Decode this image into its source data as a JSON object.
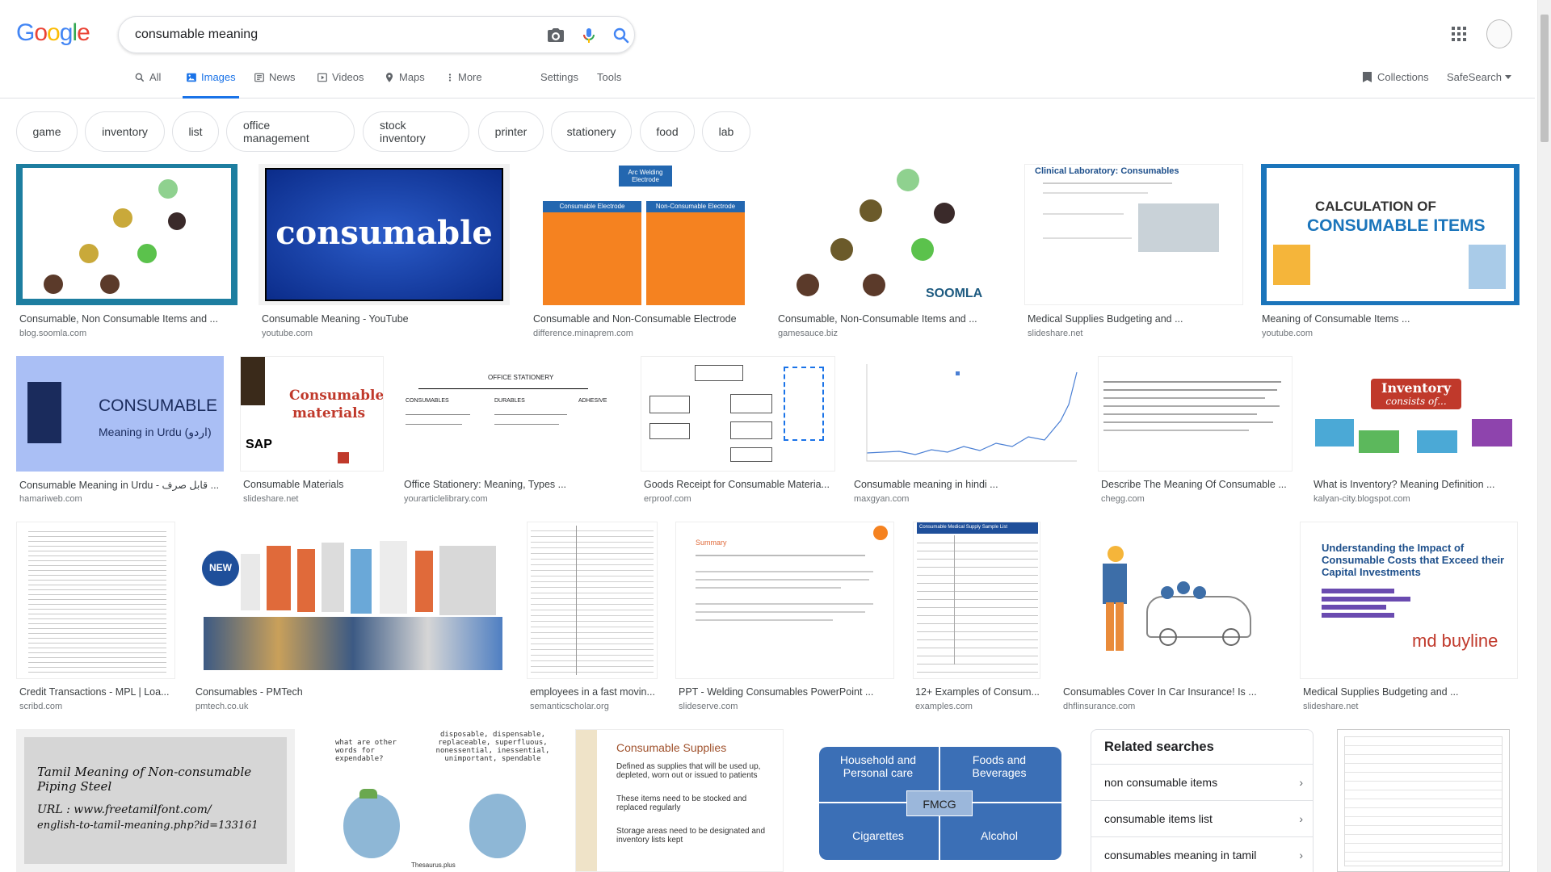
{
  "search": {
    "query": "consumable meaning"
  },
  "brand": {
    "logo": "Google",
    "colors": [
      "#4285F4",
      "#EA4335",
      "#FBBC05",
      "#4285F4",
      "#34A853",
      "#EA4335"
    ]
  },
  "tabs": [
    {
      "label": "All",
      "icon": "search-icon"
    },
    {
      "label": "Images",
      "icon": "image-icon",
      "active": true
    },
    {
      "label": "News",
      "icon": "news-icon"
    },
    {
      "label": "Videos",
      "icon": "video-icon"
    },
    {
      "label": "Maps",
      "icon": "map-icon"
    },
    {
      "label": "More",
      "icon": "more-vert-icon"
    }
  ],
  "tools": {
    "settings": "Settings",
    "tools": "Tools",
    "collections": "Collections",
    "safesearch": "SafeSearch"
  },
  "chips": [
    "game",
    "inventory",
    "list",
    "office management",
    "stock inventory",
    "printer",
    "stationery",
    "food",
    "lab"
  ],
  "results": [
    {
      "title": "Consumable, Non Consumable Items and ...",
      "source": "blog.soomla.com"
    },
    {
      "title": "Consumable Meaning - YouTube",
      "source": "youtube.com",
      "thumb_text": "consumable"
    },
    {
      "title": "Consumable and Non-Consumable Electrode",
      "source": "difference.minaprem.com",
      "thumb_text": [
        "Arc Welding Electrode",
        "Consumable Electrode",
        "Non-Consumable Electrode"
      ]
    },
    {
      "title": "Consumable, Non-Consumable Items and ...",
      "source": "gamesauce.biz",
      "thumb_text": "SOOMLA"
    },
    {
      "title": "Medical Supplies Budgeting and ...",
      "source": "slideshare.net",
      "thumb_text": "Clinical Laboratory: Consumables"
    },
    {
      "title": "Meaning of Consumable Items ...",
      "source": "youtube.com",
      "thumb_text": [
        "CALCULATION OF",
        "CONSUMABLE ITEMS"
      ]
    },
    {
      "title": "Consumable Meaning in Urdu - قابل صرف ...",
      "source": "hamariweb.com",
      "thumb_text": [
        "CONSUMABLE",
        "Meaning in Urdu (اردو)"
      ]
    },
    {
      "title": "Consumable Materials",
      "source": "slideshare.net",
      "thumb_text": [
        "Consumable",
        "materials",
        "SAP"
      ]
    },
    {
      "title": "Office Stationery: Meaning, Types ...",
      "source": "yourarticlelibrary.com",
      "thumb_text": [
        "OFFICE STATIONERY",
        "CONSUMABLES",
        "DURABLES",
        "ADHESIVE"
      ]
    },
    {
      "title": "Goods Receipt for Consumable Materia...",
      "source": "erproof.com"
    },
    {
      "title": "Consumable meaning in hindi ...",
      "source": "maxgyan.com"
    },
    {
      "title": "Describe The Meaning Of Consumable ...",
      "source": "chegg.com"
    },
    {
      "title": "What is Inventory? Meaning Definition ...",
      "source": "kalyan-city.blogspot.com",
      "thumb_text": [
        "Inventory",
        "consists of..."
      ]
    },
    {
      "title": "Credit Transactions - MPL | Loa...",
      "source": "scribd.com"
    },
    {
      "title": "Consumables - PMTech",
      "source": "pmtech.co.uk",
      "thumb_text": "NEW"
    },
    {
      "title": "employees in a fast movin...",
      "source": "semanticscholar.org"
    },
    {
      "title": "PPT - Welding Consumables PowerPoint ...",
      "source": "slideserve.com",
      "thumb_text": "Summary"
    },
    {
      "title": "12+ Examples of Consum...",
      "source": "examples.com",
      "thumb_text": "Consumable Medical Supply Sample List"
    },
    {
      "title": "Consumables Cover In Car Insurance! Is ...",
      "source": "dhflinsurance.com"
    },
    {
      "title": "Medical Supplies Budgeting and ...",
      "source": "slideshare.net",
      "thumb_text": [
        "Understanding the Impact of Consumable Costs that Exceed their Capital Investments",
        "md buyline"
      ]
    },
    {
      "title": "",
      "source": "",
      "thumb_text": [
        "Tamil Meaning of Non-consumable Piping Steel",
        "URL : www.freetamilfont.com/",
        "english-to-tamil-meaning.php?id=133161"
      ]
    },
    {
      "title": "",
      "source": "",
      "thumb_text": [
        "what are other words for expendable?",
        "disposable, dispensable, replaceable, superfluous, nonessential, inessential, unimportant, spendable",
        "Thesaurus.plus"
      ]
    },
    {
      "title": "",
      "source": "",
      "thumb_text": [
        "Consumable Supplies",
        "Defined as supplies that will be used up, depleted, worn out or issued to patients",
        "These items need to be stocked and replaced regularly",
        "Storage areas need to be designated and inventory lists kept"
      ]
    },
    {
      "title": "",
      "source": "",
      "thumb_text": [
        "Household and Personal care",
        "Foods and Beverages",
        "FMCG",
        "Cigarettes",
        "Alcohol"
      ]
    }
  ],
  "related": {
    "heading": "Related searches",
    "items": [
      "non consumable items",
      "consumable items list",
      "consumables meaning in tamil"
    ]
  }
}
